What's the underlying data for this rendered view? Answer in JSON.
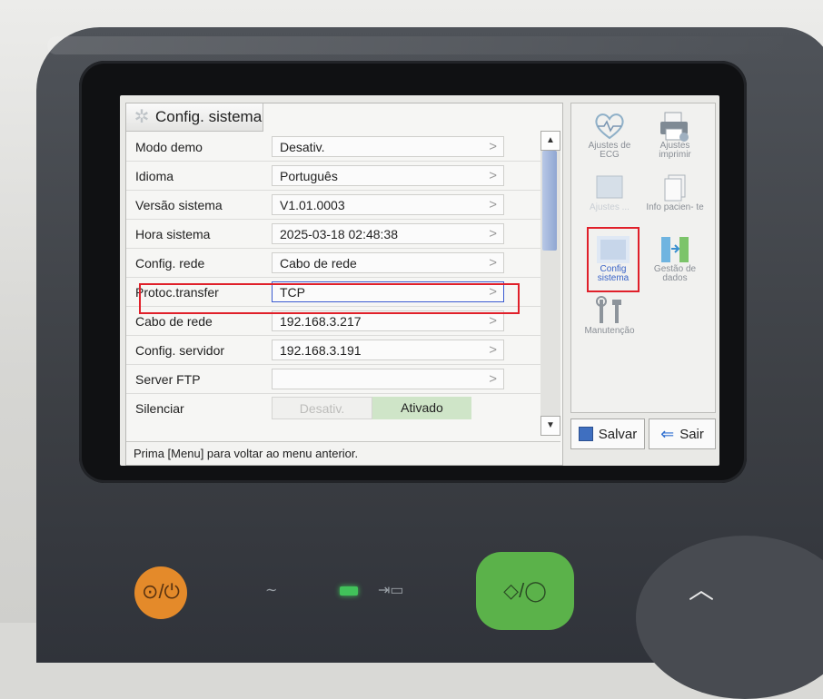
{
  "panel": {
    "title": "Config. sistema",
    "rows": [
      {
        "label": "Modo demo",
        "value": "Desativ."
      },
      {
        "label": "Idioma",
        "value": "Português"
      },
      {
        "label": "Versão sistema",
        "value": "V1.01.0003"
      },
      {
        "label": "Hora sistema",
        "value": "2025-03-18 02:48:38"
      },
      {
        "label": "Config. rede",
        "value": "Cabo de rede"
      },
      {
        "label": "Protoc.transfer",
        "value": "TCP"
      },
      {
        "label": "Cabo de rede",
        "value": "192.168.3.217"
      },
      {
        "label": "Config. servidor",
        "value": "192.168.3.191"
      },
      {
        "label": "Server FTP",
        "value": ""
      },
      {
        "label": "Silenciar",
        "off": "Desativ.",
        "on": "Ativado",
        "selected": "Ativado"
      }
    ],
    "status": "Prima [Menu] para voltar ao menu anterior."
  },
  "side": {
    "tiles": [
      {
        "label": "Ajustes de ECG",
        "icon": "ecg-heart-icon"
      },
      {
        "label": "Ajustes imprimir",
        "icon": "printer-icon"
      },
      {
        "label": "Ajustes ...",
        "icon": "screen-icon"
      },
      {
        "label": "Info pacien- te",
        "icon": "patient-document-icon"
      },
      {
        "label": "Config sistema",
        "icon": "system-config-icon",
        "active": true
      },
      {
        "label": "Gestão de dados",
        "icon": "data-management-icon"
      },
      {
        "label": "Manutenção",
        "icon": "wrench-tools-icon"
      }
    ],
    "save_label": "Salvar",
    "exit_label": "Sair"
  },
  "colors": {
    "highlight": "#e0202a",
    "selected_border": "#3b5bd0",
    "active_toggle": "#cfe5c8"
  }
}
